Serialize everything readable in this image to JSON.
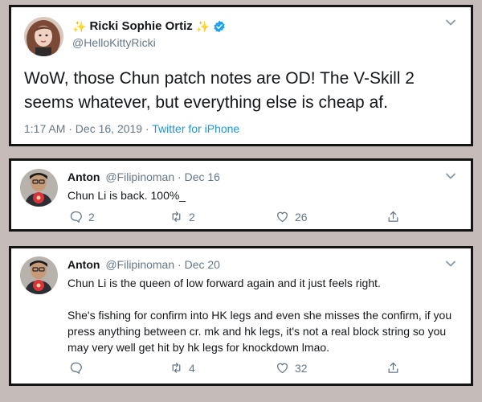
{
  "main_tweet": {
    "display_name": "Ricki Sophie Ortiz",
    "sparkle_left": "✨",
    "sparkle_right": "✨",
    "handle": "@HelloKittyRicki",
    "text": "WoW, those Chun patch notes are OD! The V-Skill 2 seems whatever, but everything else is cheap af.",
    "time": "1:17 AM · Dec 16, 2019 · ",
    "source": "Twitter for iPhone"
  },
  "reply1": {
    "name": "Anton",
    "handle": "@Filipinoman",
    "date": "· Dec 16",
    "text": "Chun Li is back. 100%_",
    "replies": "2",
    "retweets": "2",
    "likes": "26"
  },
  "reply2": {
    "name": "Anton",
    "handle": "@Filipinoman",
    "date": "· Dec 20",
    "paragraphs": [
      "Chun Li is the queen of low forward again and it just feels right.",
      "She's fishing for confirm into HK legs and even she misses the confirm, if you press anything between cr. mk and hk legs, it's not a real block string so you may very well get hit by hk legs for knockdown lmao."
    ],
    "retweets": "4",
    "likes": "32"
  },
  "colors": {
    "background": "#c5bcb9",
    "card_border": "#141414",
    "secondary_text": "#657786",
    "link": "#1b95e0",
    "verified": "#1da1f2"
  }
}
